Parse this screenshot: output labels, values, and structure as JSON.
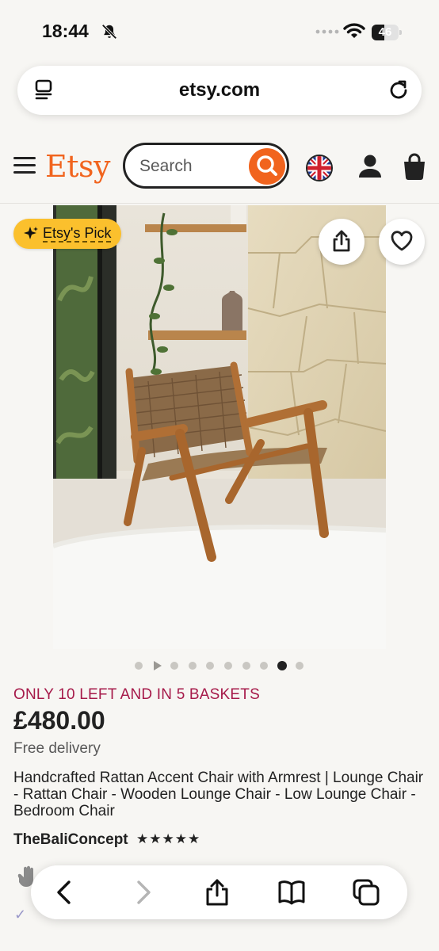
{
  "status_bar": {
    "time": "18:44",
    "battery": "46"
  },
  "browser": {
    "domain": "etsy.com"
  },
  "header": {
    "logo": "Etsy",
    "search_placeholder": "Search"
  },
  "badges": {
    "pick": "Etsy's Pick"
  },
  "gallery": {
    "total_items": 10,
    "active_index": 8,
    "has_video_at": 1
  },
  "listing": {
    "stock": "ONLY 10 LEFT AND IN 5 BASKETS",
    "price": "£480.00",
    "delivery": "Free delivery",
    "title": "Handcrafted Rattan Accent Chair with Armrest | Lounge Chair - Rattan Chair - Wooden Lounge Chair - Low Lounge Chair - Bedroom Chair",
    "shop": "TheBaliConcept",
    "rating_stars": "★★★★★",
    "rating": 5
  },
  "colors": {
    "brand": "#f1641e",
    "stock": "#a61a4a",
    "pick": "#fbc02d"
  },
  "icons": [
    "bell-slash-icon",
    "wifi-icon",
    "reader-icon",
    "reload-icon",
    "hamburger-menu-icon",
    "search-icon",
    "uk-flag-icon",
    "user-icon",
    "bag-icon",
    "sparkle-icon",
    "share-icon",
    "heart-icon",
    "back-icon",
    "forward-icon",
    "book-icon",
    "tabs-icon"
  ]
}
